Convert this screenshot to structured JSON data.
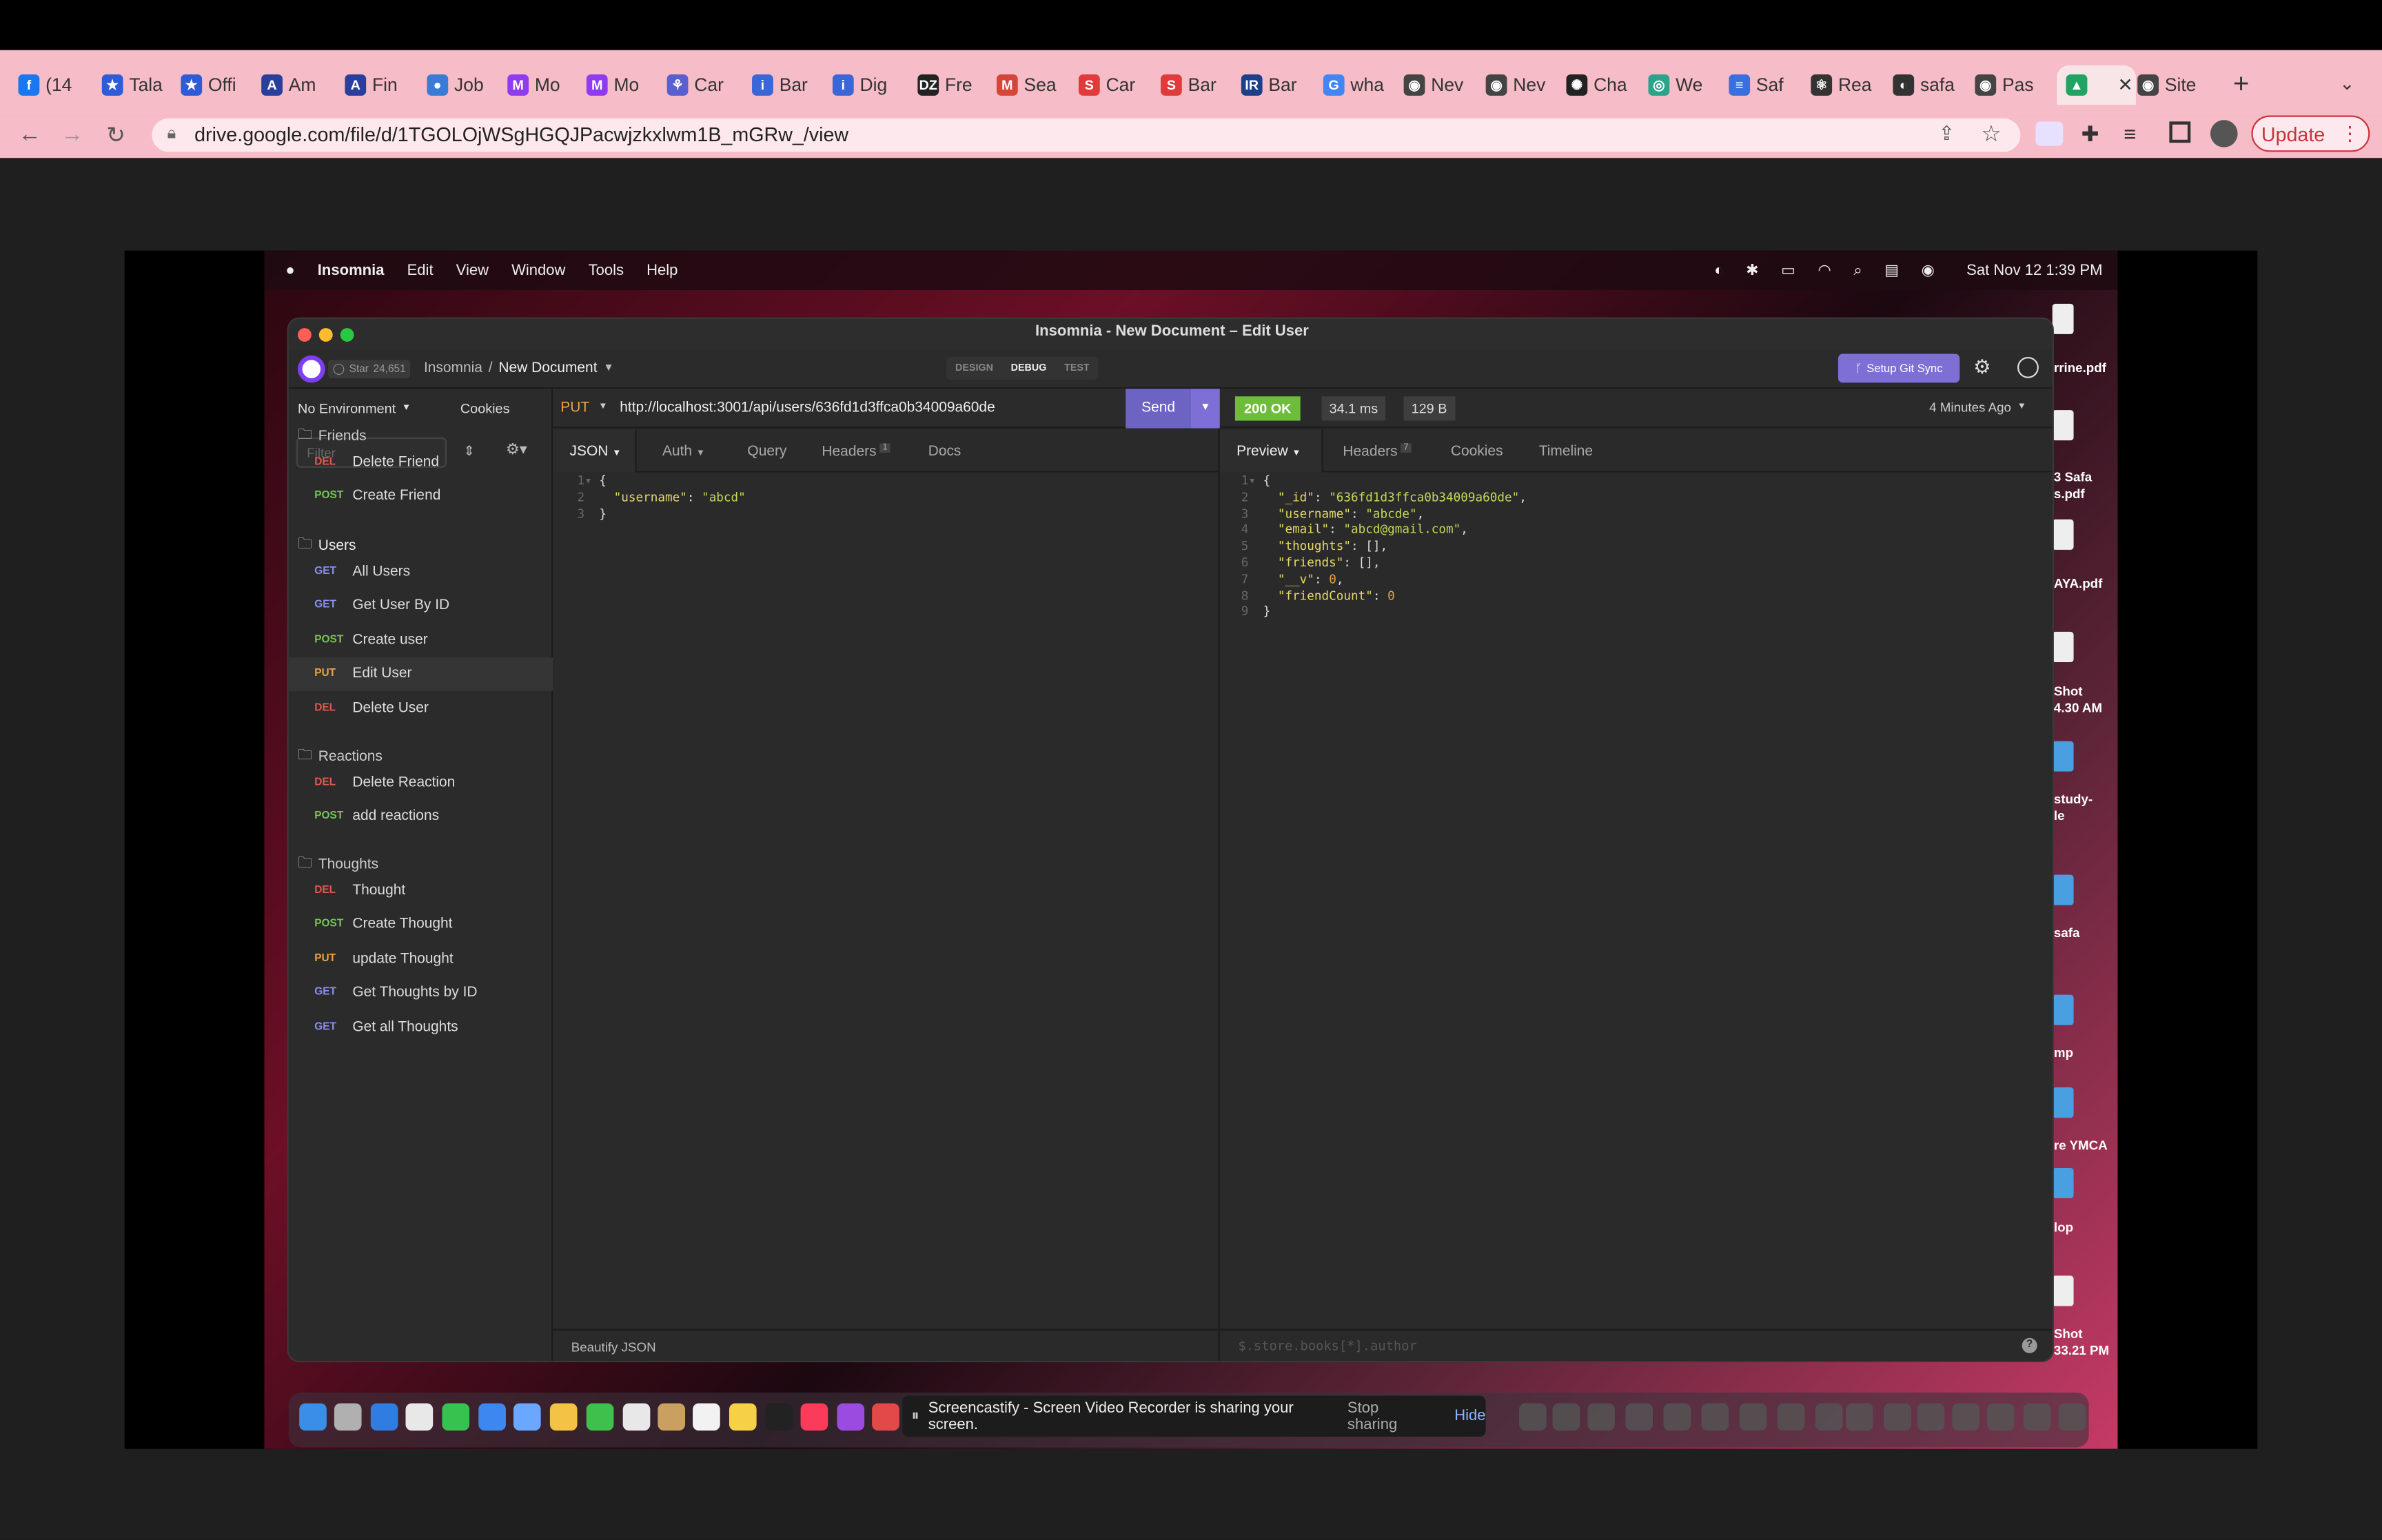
{
  "browser": {
    "tabs": [
      {
        "label": "(14",
        "color": "#1877f2",
        "glyph": "f"
      },
      {
        "label": "Tala",
        "color": "#2f5bd8",
        "glyph": "★"
      },
      {
        "label": "Offi",
        "color": "#2f5bd8",
        "glyph": "★"
      },
      {
        "label": "Am",
        "color": "#2a3e9c",
        "glyph": "A"
      },
      {
        "label": "Fin",
        "color": "#2a3e9c",
        "glyph": "A"
      },
      {
        "label": "Job",
        "color": "#3a7bd5",
        "glyph": "●"
      },
      {
        "label": "Mo",
        "color": "#8f3cf0",
        "glyph": "M"
      },
      {
        "label": "Mo",
        "color": "#8f3cf0",
        "glyph": "M"
      },
      {
        "label": "Car",
        "color": "#5a5fd0",
        "glyph": "⚘"
      },
      {
        "label": "Bar",
        "color": "#3a66d8",
        "glyph": "i"
      },
      {
        "label": "Dig",
        "color": "#3a66d8",
        "glyph": "i"
      },
      {
        "label": "Fre",
        "color": "#222222",
        "glyph": "DZ"
      },
      {
        "label": "Sea",
        "color": "#d44638",
        "glyph": "M"
      },
      {
        "label": "Car",
        "color": "#e03a3a",
        "glyph": "S"
      },
      {
        "label": "Bar",
        "color": "#e03a3a",
        "glyph": "S"
      },
      {
        "label": "Bar",
        "color": "#1d3f8a",
        "glyph": "IR"
      },
      {
        "label": "wha",
        "color": "#4285f4",
        "glyph": "G"
      },
      {
        "label": "Nev",
        "color": "#444444",
        "glyph": "◉"
      },
      {
        "label": "Nev",
        "color": "#444444",
        "glyph": "◉"
      },
      {
        "label": "Cha",
        "color": "#222222",
        "glyph": "✺"
      },
      {
        "label": "We",
        "color": "#2aa38a",
        "glyph": "◎"
      },
      {
        "label": "Saf",
        "color": "#3b6fe0",
        "glyph": "≡"
      },
      {
        "label": "Rea",
        "color": "#333333",
        "glyph": "⚛"
      },
      {
        "label": "safa",
        "color": "#333333",
        "glyph": "◐"
      },
      {
        "label": "Pas",
        "color": "#444444",
        "glyph": "◉"
      },
      {
        "label": "",
        "color": "#1fa463",
        "glyph": "▲"
      },
      {
        "label": "Site",
        "color": "#444444",
        "glyph": "◉"
      }
    ],
    "url": "drive.google.com/file/d/1TGOLOjWSgHGQJPacwjzkxlwm1B_mGRw_/view",
    "update_label": "Update",
    "new_tab": "+"
  },
  "mac": {
    "app": "Insomnia",
    "menus": [
      "Edit",
      "View",
      "Window",
      "Tools",
      "Help"
    ],
    "clock": "Sat Nov 12  1:39 PM"
  },
  "insomnia": {
    "window_title": "Insomnia - New Document – Edit User",
    "star_label": "Star",
    "star_count": "24,651",
    "breadcrumb_root": "Insomnia",
    "breadcrumb_sep": "/",
    "document": "New Document",
    "mode_tabs": [
      "DESIGN",
      "DEBUG",
      "TEST"
    ],
    "git_sync": "Setup Git Sync",
    "environment": "No Environment",
    "cookies": "Cookies",
    "filter_placeholder": "Filter",
    "method": "PUT",
    "request_url": "http://localhost:3001/api/users/636fd1d3ffca0b34009a60de",
    "send": "Send",
    "status": "200 OK",
    "time": "34.1 ms",
    "size": "129 B",
    "ago": "4 Minutes Ago",
    "request_tabs": {
      "body": "JSON",
      "auth": "Auth",
      "query": "Query",
      "headers": "Headers",
      "headers_count": "1",
      "docs": "Docs"
    },
    "response_tabs": {
      "preview": "Preview",
      "headers": "Headers",
      "headers_count": "7",
      "cookies": "Cookies",
      "timeline": "Timeline"
    },
    "beautify": "Beautify JSON",
    "filter_query": "$.store.books[*].author",
    "help_icon": "?",
    "sidebar": {
      "folders": [
        "Friends",
        "Users",
        "Reactions",
        "Thoughts"
      ],
      "friends": [
        {
          "method": "DEL",
          "label": "Delete Friend"
        },
        {
          "method": "POST",
          "label": "Create Friend"
        }
      ],
      "users": [
        {
          "method": "GET",
          "label": "All Users"
        },
        {
          "method": "GET",
          "label": "Get User By ID"
        },
        {
          "method": "POST",
          "label": "Create user"
        },
        {
          "method": "PUT",
          "label": "Edit User"
        },
        {
          "method": "DEL",
          "label": "Delete User"
        }
      ],
      "reactions": [
        {
          "method": "DEL",
          "label": "Delete Reaction"
        },
        {
          "method": "POST",
          "label": "add reactions"
        }
      ],
      "thoughts": [
        {
          "method": "DEL",
          "label": "Thought"
        },
        {
          "method": "POST",
          "label": "Create Thought"
        },
        {
          "method": "PUT",
          "label": "update Thought"
        },
        {
          "method": "GET",
          "label": "Get Thoughts by ID"
        },
        {
          "method": "GET",
          "label": "Get all Thoughts"
        }
      ]
    },
    "request_body_key": "\"username\"",
    "request_body_value": "\"abcd\"",
    "response_lines": [
      {
        "key": "\"_id\"",
        "value": "\"636fd1d3ffca0b34009a60de\"",
        "type": "s",
        "trail": ","
      },
      {
        "key": "\"username\"",
        "value": "\"abcde\"",
        "type": "s",
        "trail": ","
      },
      {
        "key": "\"email\"",
        "value": "\"abcd@gmail.com\"",
        "type": "s",
        "trail": ","
      },
      {
        "key": "\"thoughts\"",
        "value": "[]",
        "type": "p",
        "trail": ","
      },
      {
        "key": "\"friends\"",
        "value": "[]",
        "type": "p",
        "trail": ","
      },
      {
        "key": "\"__v\"",
        "value": "0",
        "type": "n",
        "trail": ","
      },
      {
        "key": "\"friendCount\"",
        "value": "0",
        "type": "n",
        "trail": ""
      }
    ]
  },
  "desktop_files": [
    "rrine.pdf",
    "3 Safa",
    "s.pdf",
    "AYA.pdf",
    "Shot",
    "4.30 AM",
    "study-",
    "le",
    "safa",
    "mp",
    "re YMCA",
    "lop",
    "Shot",
    "33.21 PM"
  ],
  "screencastify": {
    "message": "Screencastify - Screen Video Recorder is sharing your screen.",
    "stop": "Stop sharing",
    "hide": "Hide"
  },
  "colors": {
    "accent": "#7e6fd6",
    "ok": "#6ebd3a",
    "chrome_tab": "#f6bcc7"
  }
}
